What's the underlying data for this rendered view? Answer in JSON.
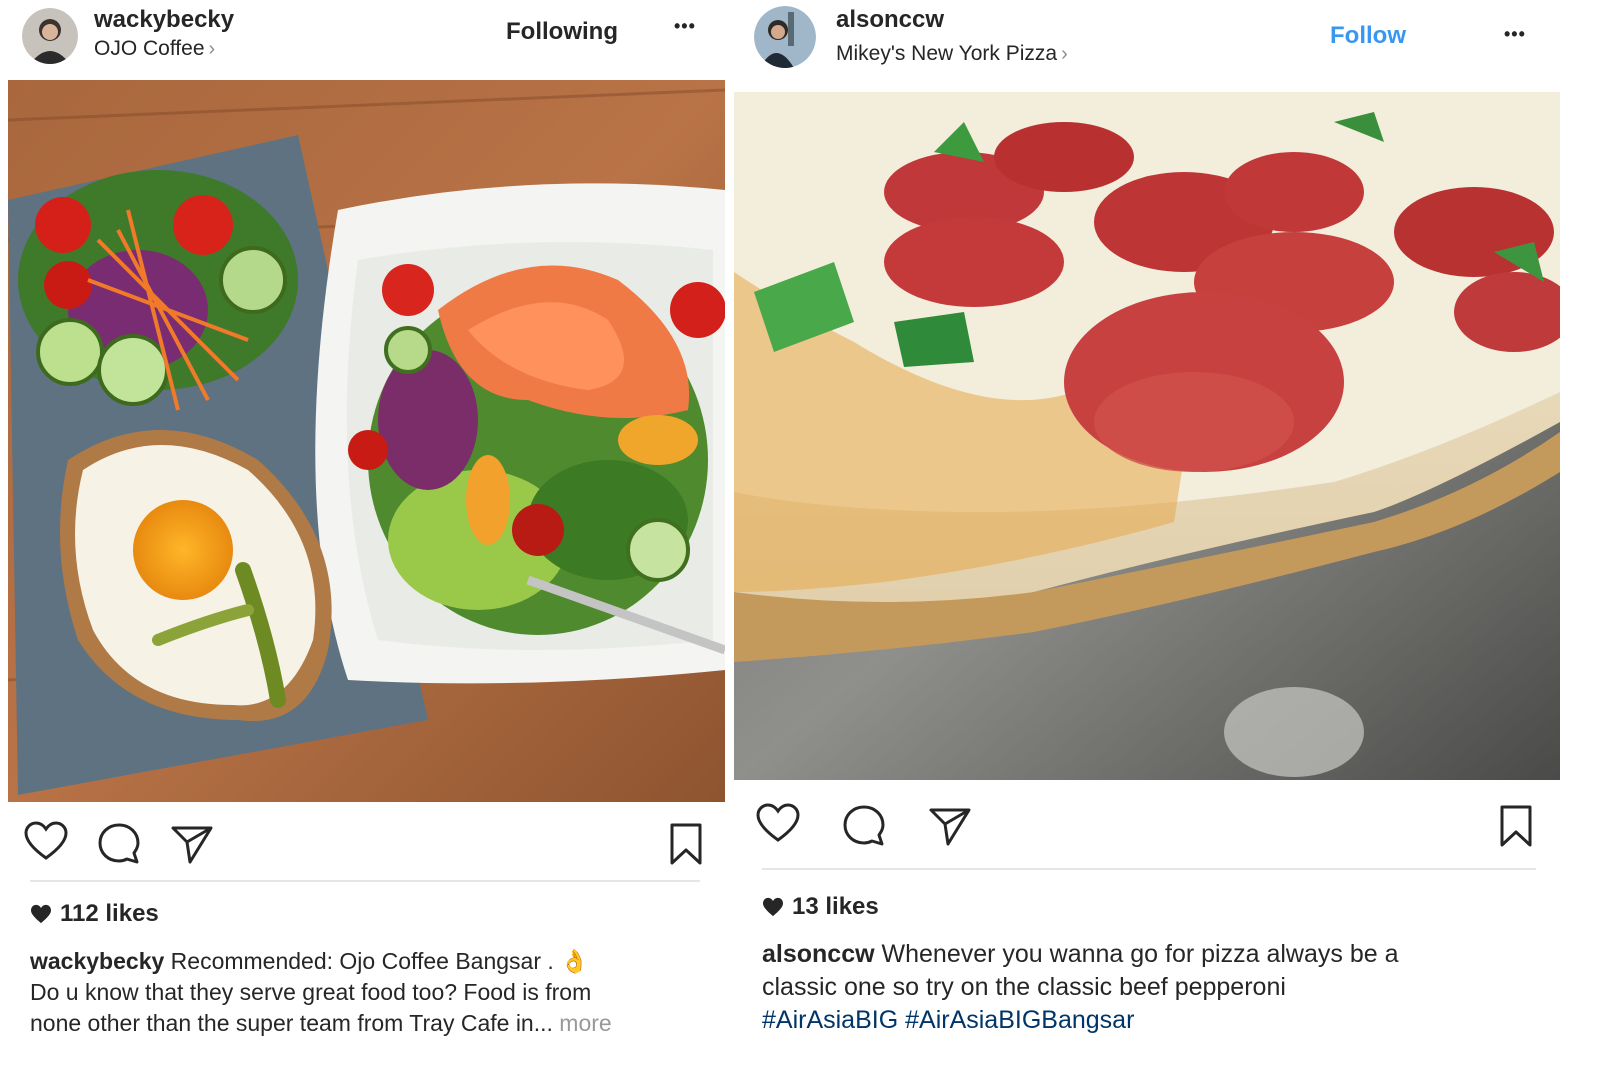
{
  "left_post": {
    "username": "wackybecky",
    "location": "OJO Coffee",
    "follow_state": "Following",
    "more_label": "•••",
    "likes": "112 likes",
    "caption_user": "wackybecky",
    "caption_line1": "Recommended:  Ojo Coffee Bangsar . ",
    "caption_emoji": "👌",
    "caption_line2": "Do u know that they serve great food too? Food is from",
    "caption_line3": "none other than the super team from Tray Cafe in...",
    "caption_more": "more",
    "icons": [
      "heart-icon",
      "comment-icon",
      "share-icon",
      "bookmark-icon"
    ]
  },
  "right_post": {
    "username": "alsonccw",
    "location": "Mikey's New York Pizza",
    "follow_state": "Follow",
    "more_label": "•••",
    "likes": "13 likes",
    "caption_user": "alsonccw",
    "caption_line1": "Whenever you wanna go for pizza always be a",
    "caption_line2": "classic one so try on the classic beef pepperoni",
    "hashtag1": "#AirAsiaBIG",
    "hashtag2": "#AirAsiaBIGBangsar",
    "icons": [
      "heart-icon",
      "comment-icon",
      "share-icon",
      "bookmark-icon"
    ]
  },
  "colors": {
    "follow_blue": "#3897f0",
    "hashtag_blue": "#003569",
    "text": "#262626",
    "muted": "#999999"
  }
}
